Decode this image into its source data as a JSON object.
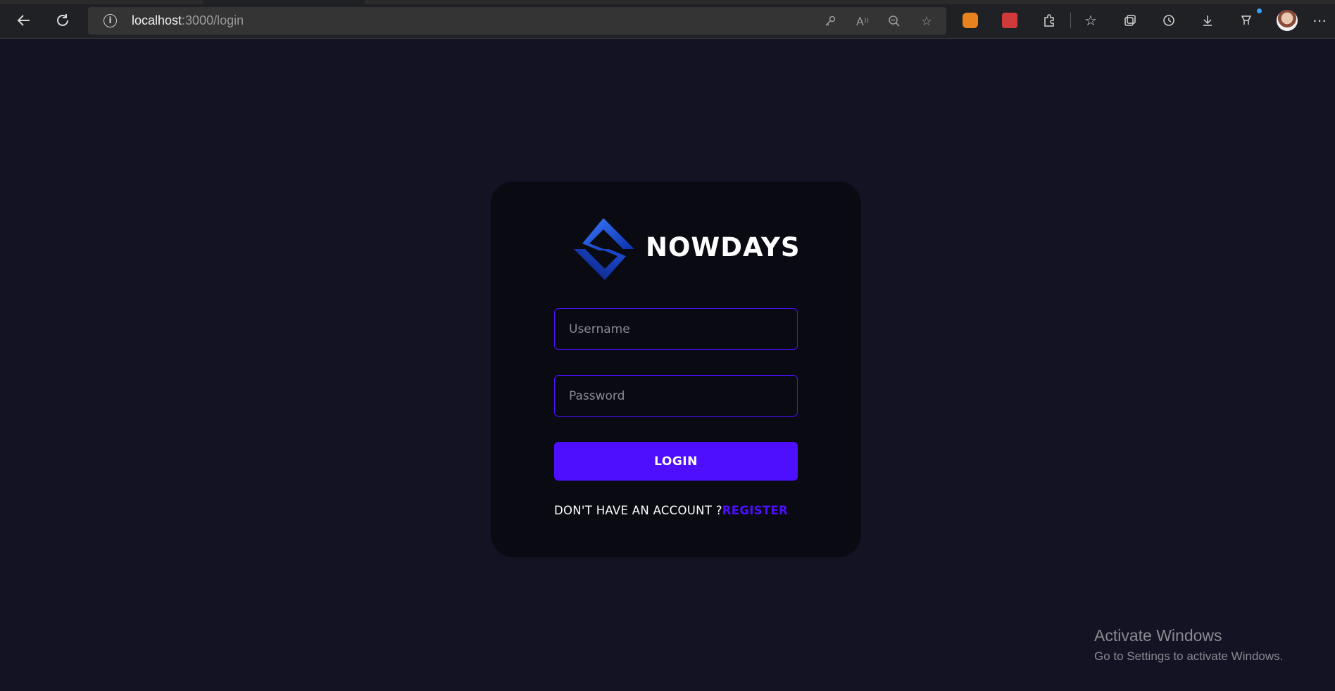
{
  "browser": {
    "back_icon": "arrow-left-icon",
    "refresh_icon": "refresh-icon",
    "info_icon": "info-icon",
    "url_host": "localhost",
    "url_path": ":3000/login",
    "address_icons": [
      "key-icon",
      "read-aloud-icon",
      "zoom-out-icon",
      "add-favorite-icon"
    ],
    "toolbar_icons": [
      "fox-extension-icon",
      "red-extension-icon",
      "extensions-icon",
      "favorites-icon",
      "collections-icon",
      "history-icon",
      "downloads-icon",
      "copilot-icon",
      "profile-avatar",
      "more-icon"
    ]
  },
  "login": {
    "brand_name": "NOWDAYS",
    "username_placeholder": "Username",
    "password_placeholder": "Password",
    "login_label": "LOGIN",
    "register_prompt": "DON'T HAVE AN ACCOUNT ?",
    "register_link": "REGISTER"
  },
  "colors": {
    "page_background": "#131324",
    "card_background": "#0a0a13",
    "accent": "#4e0eff",
    "text": "#ffffff"
  },
  "watermark": {
    "title": "Activate Windows",
    "subtitle": "Go to Settings to activate Windows."
  }
}
